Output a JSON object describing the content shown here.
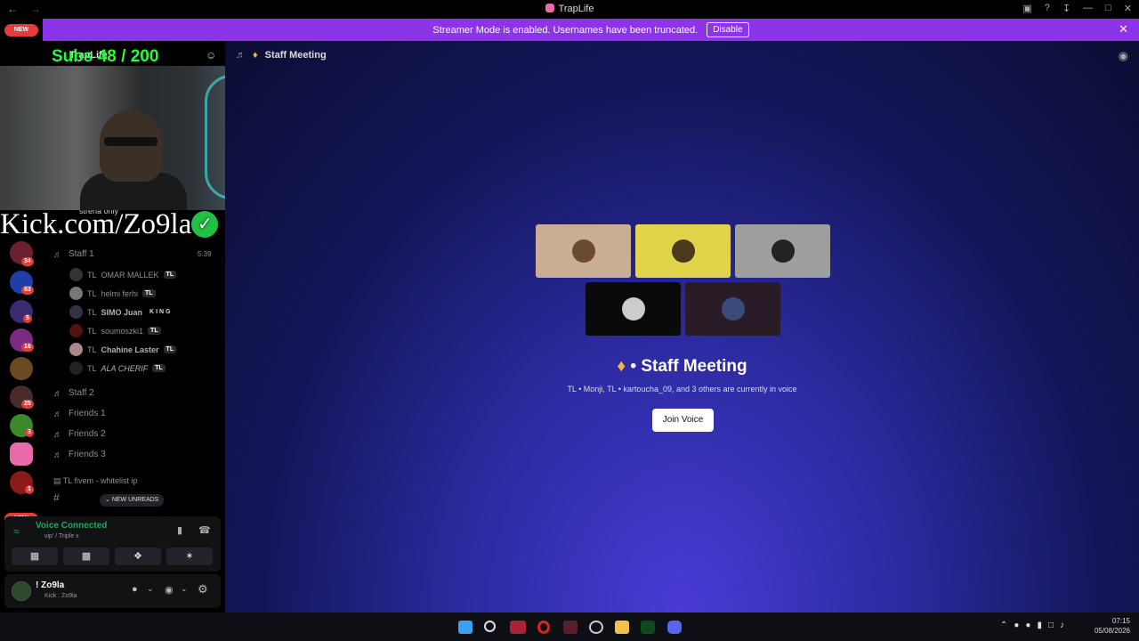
{
  "window": {
    "title": "TrapLife"
  },
  "banner": {
    "message": "Streamer Mode is enabled. Usernames have been truncated.",
    "disable_label": "Disable"
  },
  "servers": {
    "new_label_top": "NEW",
    "new_label_bottom": "NEW",
    "badges": [
      "34",
      "63",
      "5",
      "16",
      "25",
      "3",
      "1"
    ]
  },
  "overlay": {
    "subs": "Subs 48 / 200",
    "kick": "Kick.com/Zo9la"
  },
  "sidebar": {
    "server_name": "TrapLife",
    "partial_label": "strena only",
    "channels": [
      {
        "label": "Staff 1",
        "time": "5:39"
      },
      {
        "label": "Staff 2"
      },
      {
        "label": "Friends 1"
      },
      {
        "label": "Friends 2"
      },
      {
        "label": "Friends 3"
      }
    ],
    "members": [
      {
        "prefix": "TL",
        "name": "OMAR MALLEK",
        "tag": "TL"
      },
      {
        "prefix": "TL",
        "name": "helmi ferhi",
        "tag": "TL"
      },
      {
        "prefix": "TL",
        "name": "SIMO Juan",
        "tag": "KING"
      },
      {
        "prefix": "TL",
        "name": "soumoszki1",
        "tag": "TL"
      },
      {
        "prefix": "TL",
        "name": "Chahine Laster",
        "tag": "TL"
      },
      {
        "prefix": "TL",
        "name": "ALA CHERIF",
        "tag": "TL"
      }
    ],
    "category": "TL fivem - whitelist ip",
    "new_unreads": "NEW UNREADS"
  },
  "voice_panel": {
    "status": "Voice Connected",
    "channel": "vip' / Triple x"
  },
  "user_panel": {
    "name": "! Zo9la",
    "status": "Kick : Zo9la"
  },
  "main": {
    "channel_title": "Staff Meeting",
    "stage_title": "Staff Meeting",
    "participants_text": "TL • Monji, TL • kartoucha_09, and 3 others are currently in voice",
    "join_label": "Join Voice"
  },
  "taskbar": {
    "time": "07:15",
    "date": "05/08/2026"
  },
  "colors": {
    "banner": "#8b34e8",
    "accent_green": "#23a55a",
    "badge_red": "#e23c3c"
  }
}
